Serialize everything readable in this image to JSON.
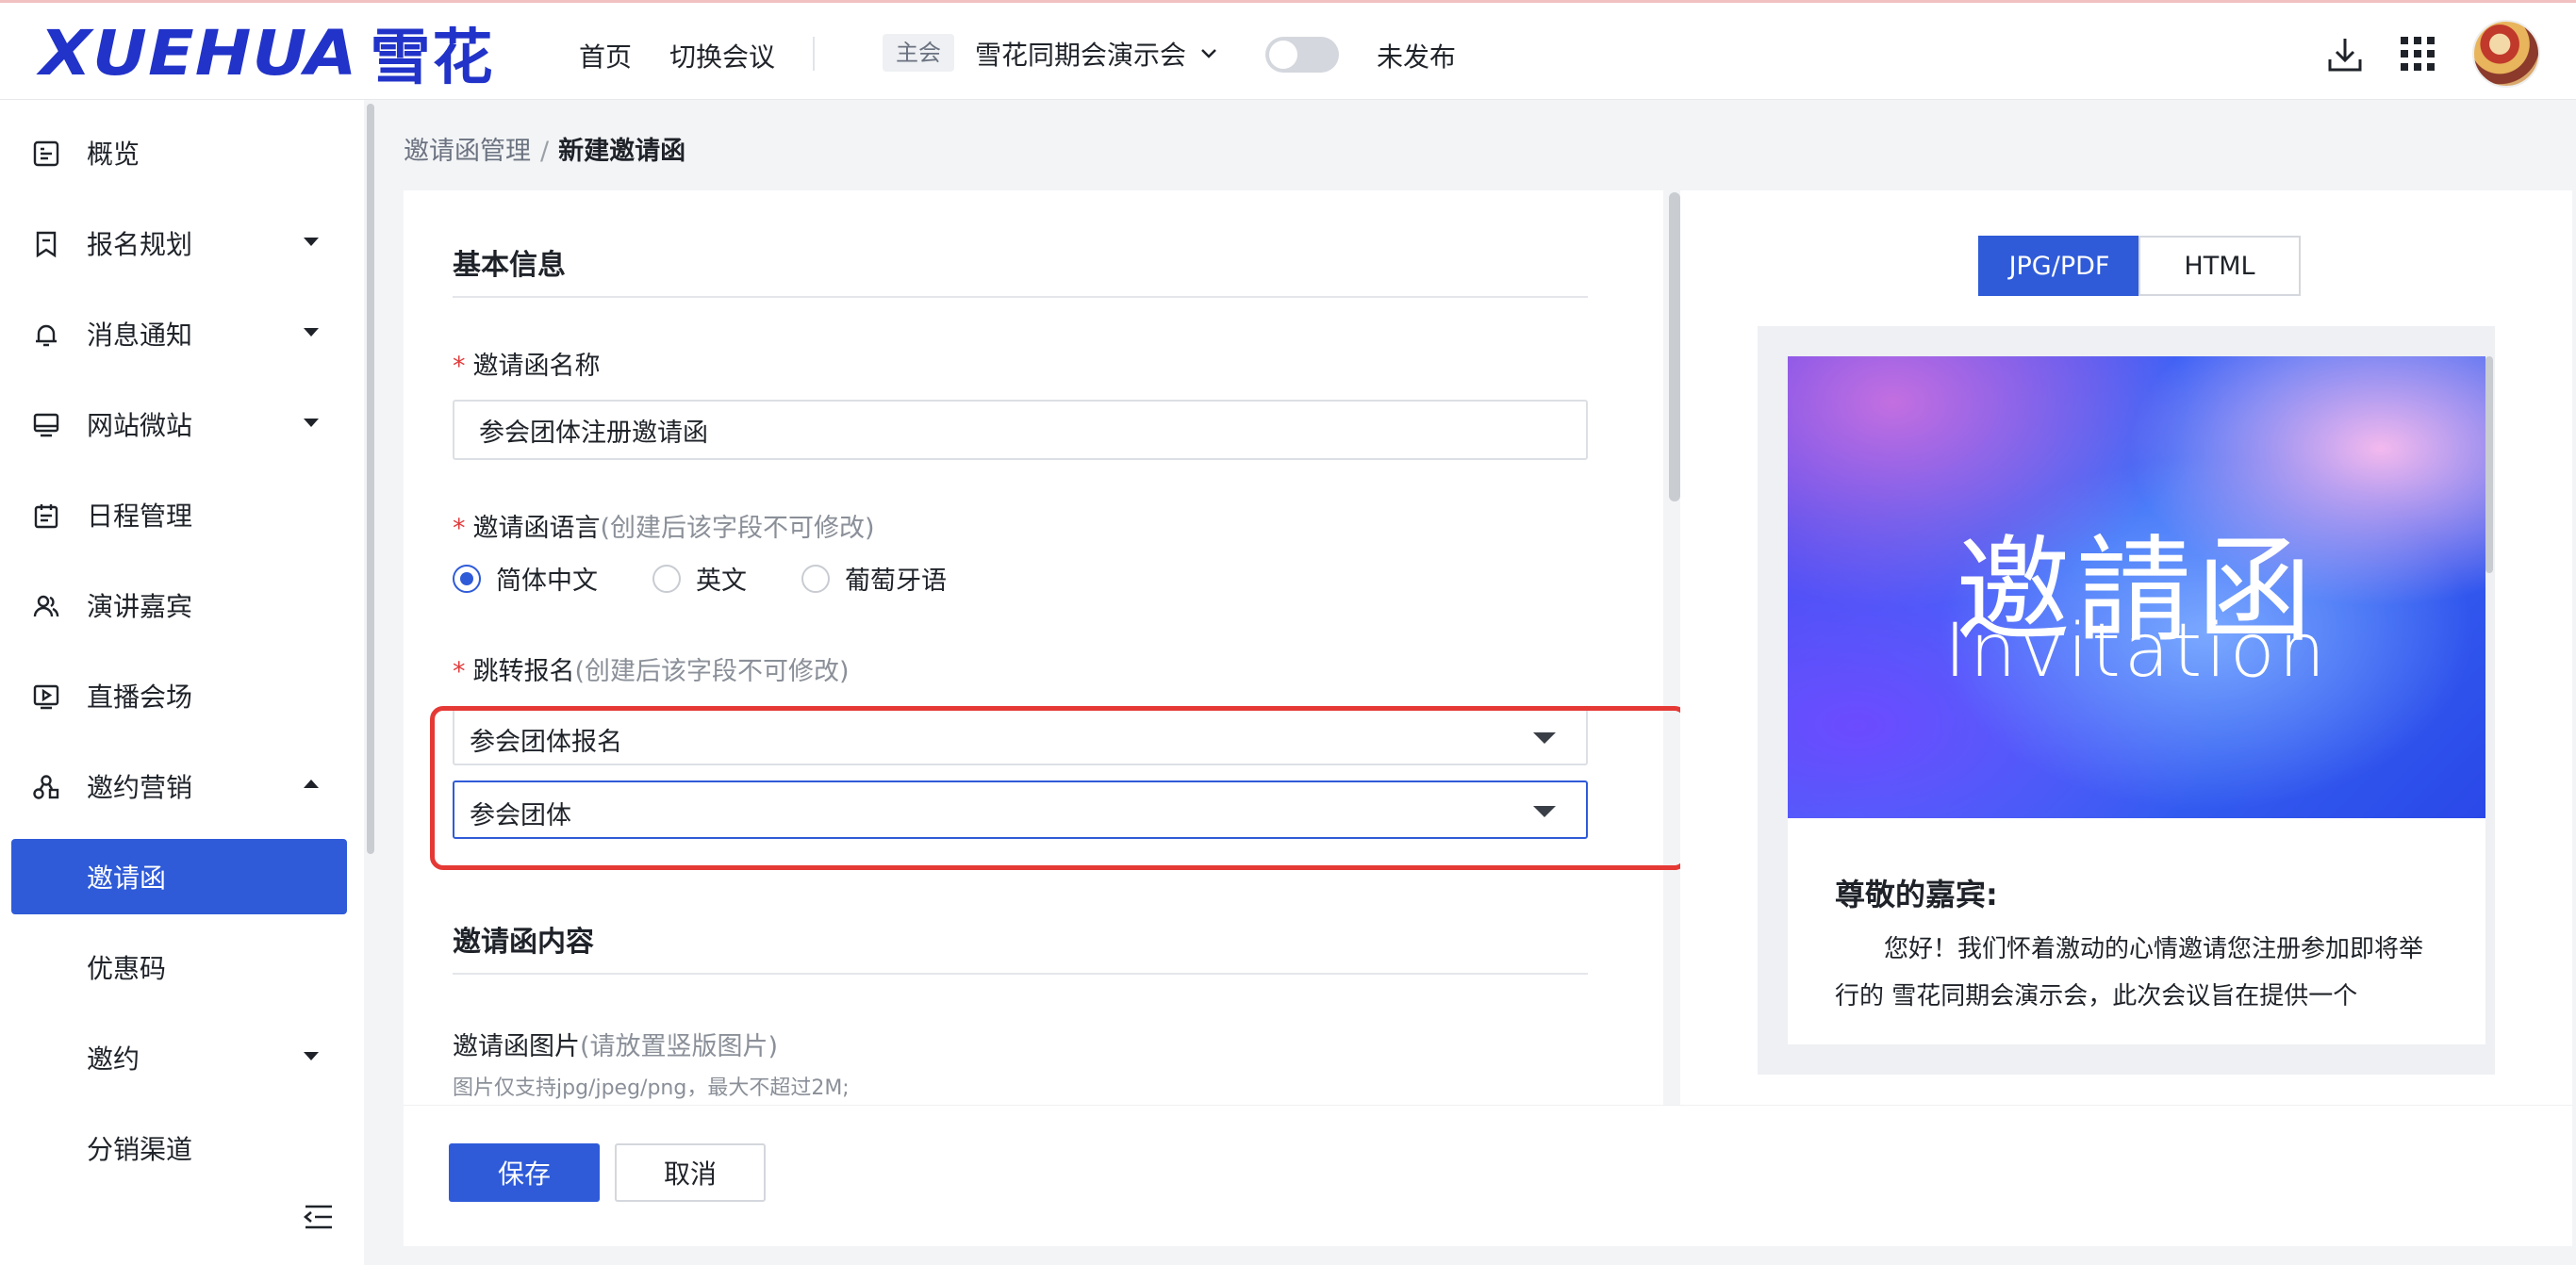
{
  "header": {
    "logo_en": "XUEHUA",
    "logo_cn": "雪花",
    "nav": {
      "home": "首页",
      "switch_meeting": "切换会议"
    },
    "host_tag": "主会",
    "meeting_name": "雪花同期会演示会",
    "publish_status": "未发布"
  },
  "sidebar": {
    "items": [
      {
        "label": "概览"
      },
      {
        "label": "报名规划"
      },
      {
        "label": "消息通知"
      },
      {
        "label": "网站微站"
      },
      {
        "label": "日程管理"
      },
      {
        "label": "演讲嘉宾"
      },
      {
        "label": "直播会场"
      },
      {
        "label": "邀约营销"
      },
      {
        "label": "邀请函"
      },
      {
        "label": "优惠码"
      },
      {
        "label": "邀约"
      },
      {
        "label": "分销渠道"
      }
    ]
  },
  "breadcrumb": {
    "parent": "邀请函管理",
    "separator": "/",
    "current": "新建邀请函"
  },
  "form": {
    "section_basic": "基本信息",
    "name_label": "邀请函名称",
    "name_value": "参会团体注册邀请函",
    "lang_label": "邀请函语言",
    "lang_hint": "(创建后该字段不可修改)",
    "lang_options": [
      "简体中文",
      "英文",
      "葡萄牙语"
    ],
    "jump_label": "跳转报名",
    "jump_hint": "(创建后该字段不可修改)",
    "select1_value": "参会团体报名",
    "select2_value": "参会团体",
    "section_content": "邀请函内容",
    "image_label": "邀请函图片",
    "image_hint": "(请放置竖版图片)",
    "image_note": "图片仅支持jpg/jpeg/png，最大不超过2M;",
    "required_mark": "*"
  },
  "buttons": {
    "save": "保存",
    "cancel": "取消"
  },
  "preview": {
    "tabs": [
      "JPG/PDF",
      "HTML"
    ],
    "hero_cn": "邀請函",
    "hero_en": "Invitation",
    "greeting": "尊敬的嘉宾:",
    "body": "您好！我们怀着激动的心情邀请您注册参加即将举行的 雪花同期会演示会，此次会议旨在提供一个"
  },
  "colors": {
    "brand": "#2133c8",
    "primary": "#2f5bd8",
    "highlight": "#e53935"
  }
}
